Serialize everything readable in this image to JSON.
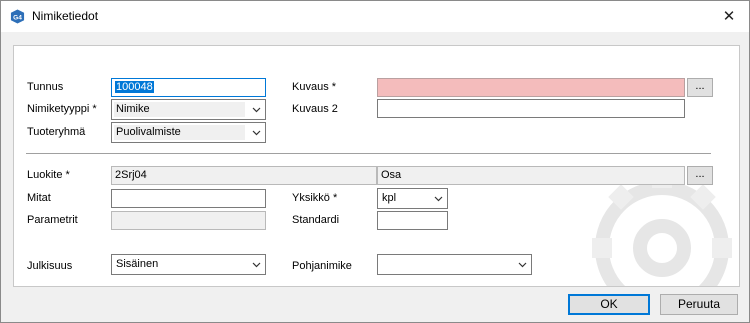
{
  "window": {
    "title": "Nimiketiedot",
    "app_icon": "G4",
    "close_glyph": "✕"
  },
  "fields": {
    "tunnus": {
      "label": "Tunnus",
      "value": "100048"
    },
    "nimiketyyppi": {
      "label": "Nimiketyyppi *",
      "value": "Nimike"
    },
    "tuoteryhma": {
      "label": "Tuoteryhmä",
      "value": "Puolivalmiste"
    },
    "kuvaus": {
      "label": "Kuvaus *",
      "value": ""
    },
    "kuvaus2": {
      "label": "Kuvaus 2",
      "value": ""
    },
    "luokite": {
      "label": "Luokite *",
      "code": "2Srj04",
      "name": "Osa"
    },
    "mitat": {
      "label": "Mitat",
      "value": ""
    },
    "yksikko": {
      "label": "Yksikkö *",
      "value": "kpl"
    },
    "parametrit": {
      "label": "Parametrit",
      "value": ""
    },
    "standardi": {
      "label": "Standardi",
      "value": ""
    },
    "julkisuus": {
      "label": "Julkisuus",
      "value": "Sisäinen"
    },
    "pohjanimike": {
      "label": "Pohjanimike",
      "value": ""
    }
  },
  "ellipsis_label": "...",
  "buttons": {
    "ok": "OK",
    "cancel": "Peruuta"
  },
  "colors": {
    "required_field": "#f4bcbc",
    "accent": "#0078d7"
  },
  "icons": {
    "app": "g4-logo-icon",
    "close": "close-icon",
    "dropdown": "chevron-down-icon",
    "background": "gear-watermark-icon"
  }
}
